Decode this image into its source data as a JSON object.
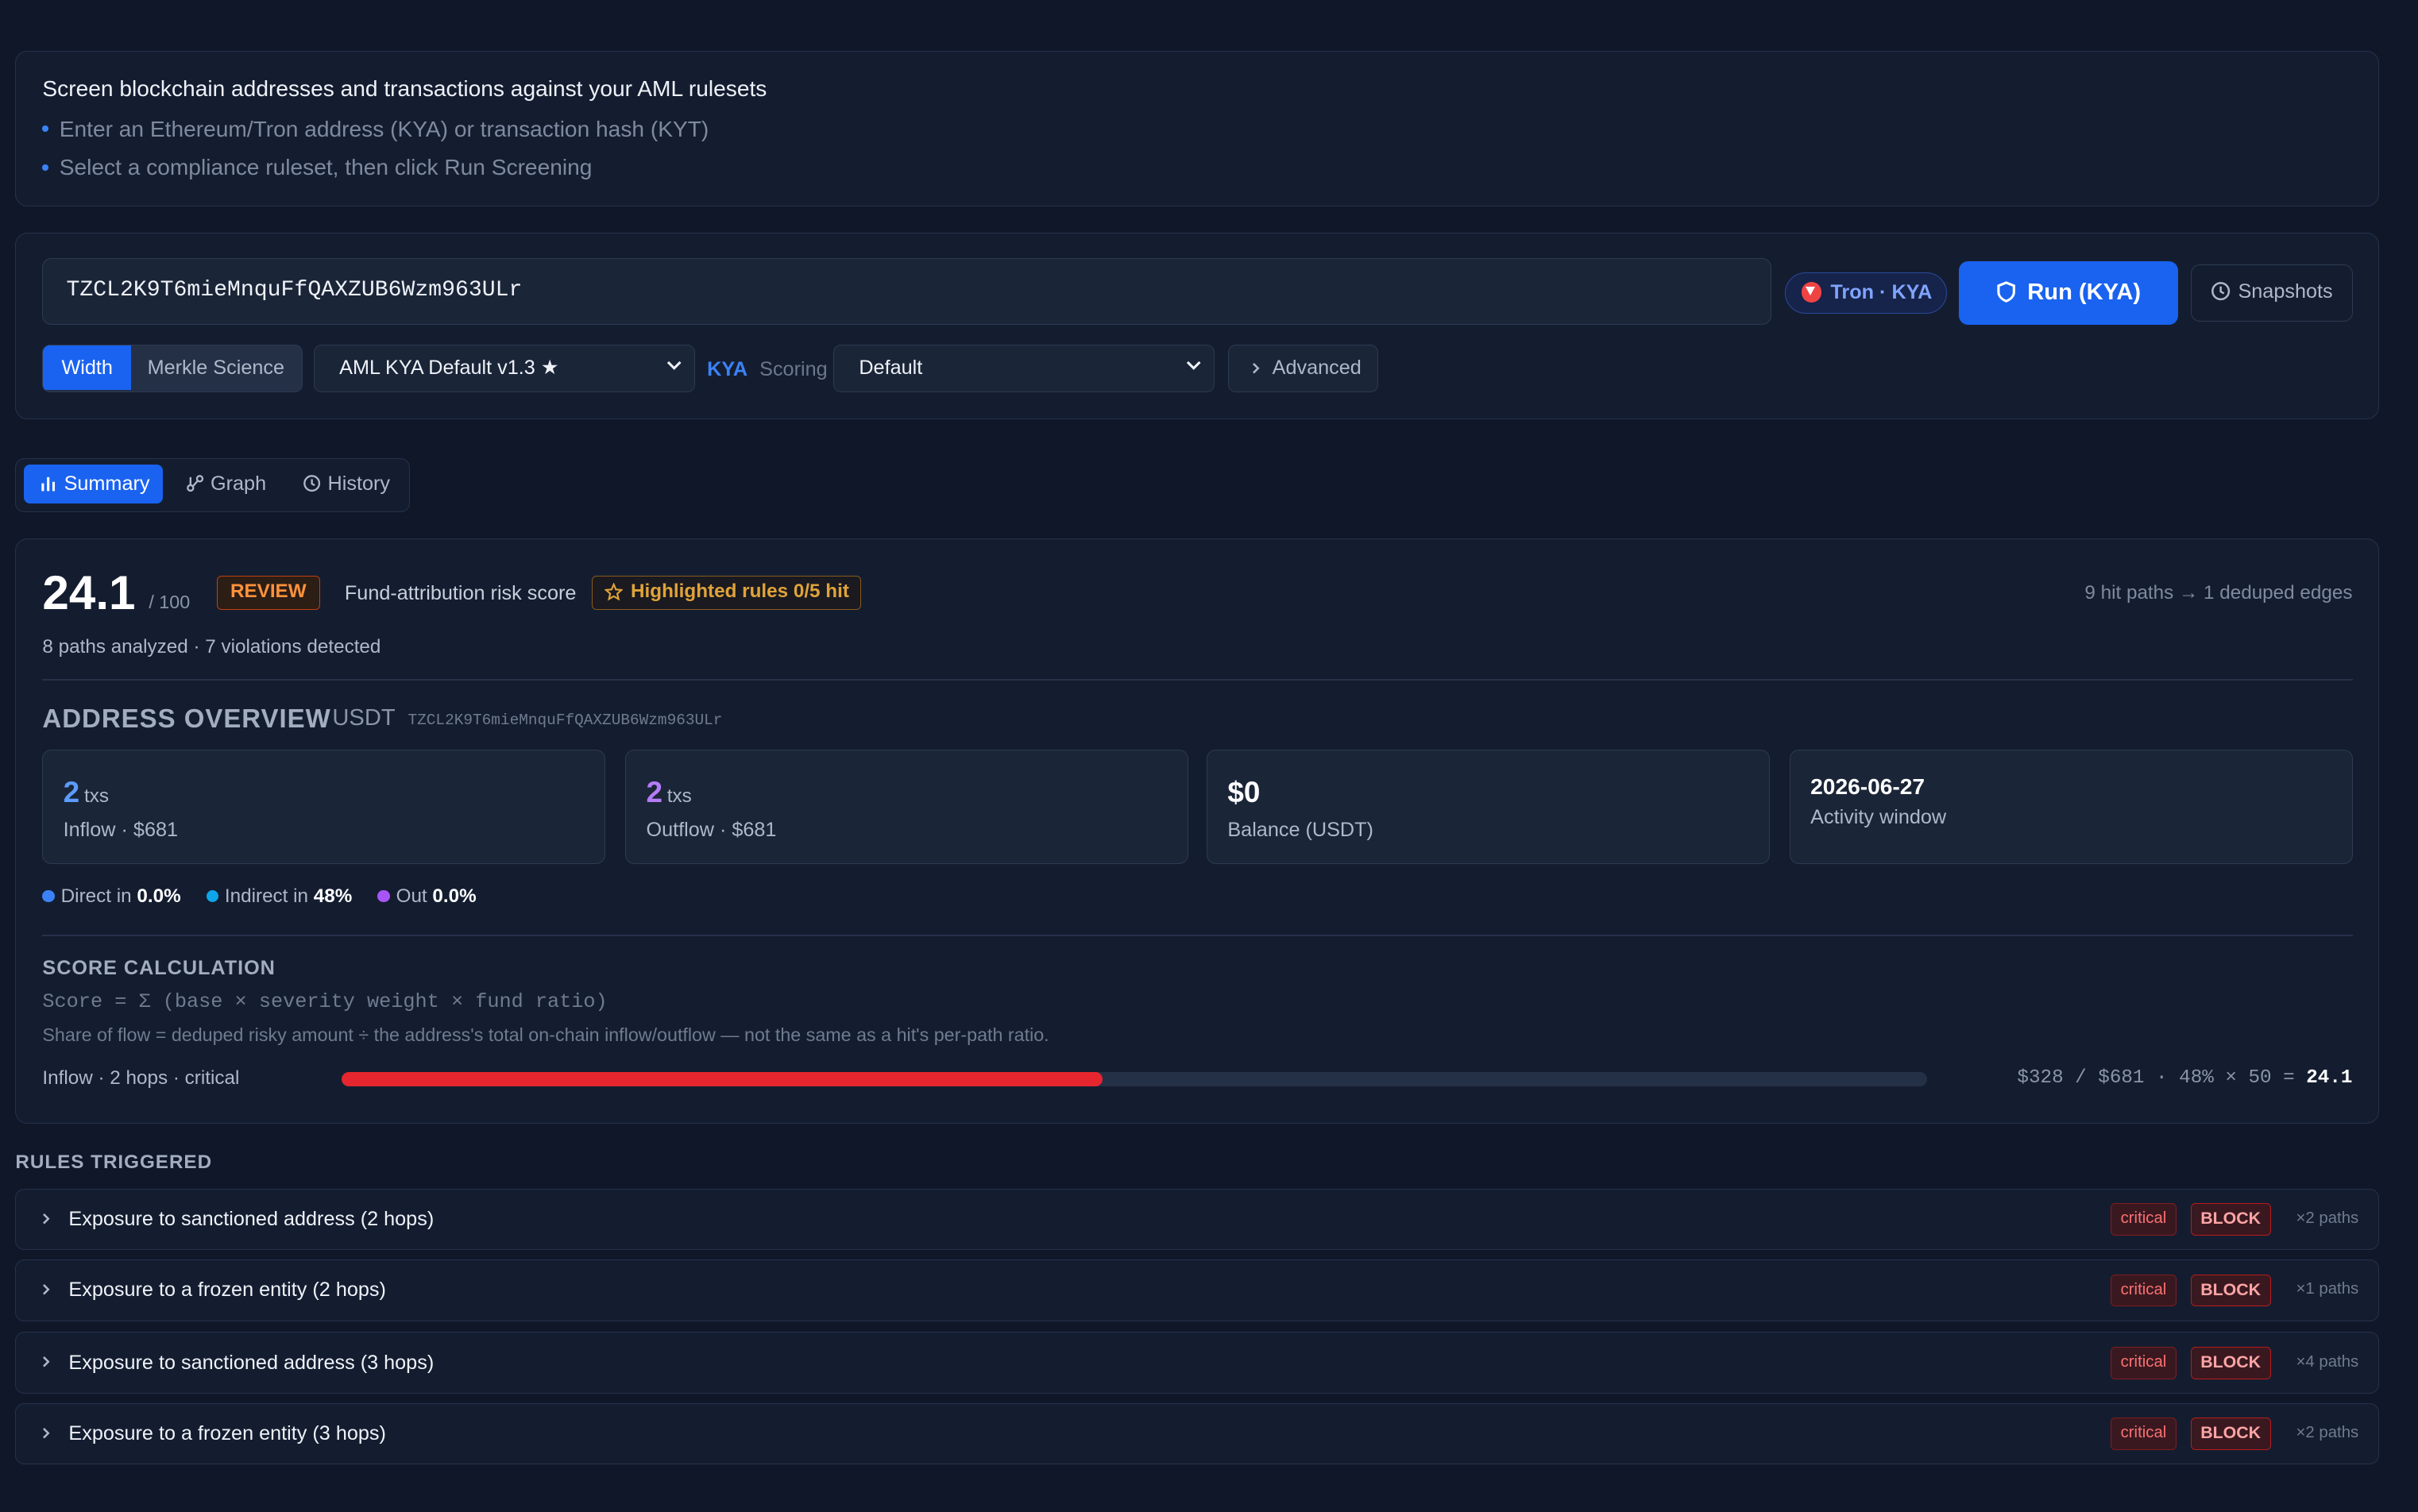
{
  "intro": {
    "title": "Screen blockchain addresses and transactions against your AML rulesets",
    "bullets": [
      "Enter an Ethereum/Tron address (KYA) or transaction hash (KYT)",
      "Select a compliance ruleset, then click Run Screening"
    ]
  },
  "input": {
    "address": "TZCL2K9T6mieMnquFfQAXZUB6Wzm963ULr",
    "chain_badge": "Tron · KYA",
    "run_label": "Run (KYA)",
    "snapshots_label": "Snapshots",
    "providers": [
      "Width",
      "Merkle Science"
    ],
    "ruleset": "AML KYA Default v1.3 ★",
    "mode_label": "KYA",
    "scoring_label": "Scoring",
    "scoring_value": "Default",
    "advanced_label": "Advanced"
  },
  "tabs": [
    "Summary",
    "Graph",
    "History"
  ],
  "summary": {
    "score": "24.1",
    "score_of": "/ 100",
    "verdict": "REVIEW",
    "score_label": "Fund-attribution risk score",
    "highlighted": "Highlighted rules 0/5 hit",
    "hit_paths": "9 hit paths → 1 deduped edges",
    "paths_line": "8 paths analyzed · 7 violations detected",
    "overview_title": "ADDRESS OVERVIEW",
    "overview_token": "USDT",
    "overview_address": "TZCL2K9T6mieMnquFfQAXZUB6Wzm963ULr",
    "cards": {
      "inflow": {
        "value": "2",
        "unit": "txs",
        "sub": "Inflow · $681"
      },
      "outflow": {
        "value": "2",
        "unit": "txs",
        "sub": "Outflow · $681"
      },
      "balance": {
        "value": "$0",
        "sub": "Balance (USDT)"
      },
      "window": {
        "value": "2026-06-27",
        "sub": "Activity window"
      }
    },
    "legend": [
      {
        "label": "Direct in",
        "value": "0.0%",
        "color": "#3b82f6"
      },
      {
        "label": "Indirect in",
        "value": "48%",
        "color": "#0ea5e9"
      },
      {
        "label": "Out",
        "value": "0.0%",
        "color": "#a855f7"
      }
    ],
    "calc_title": "SCORE CALCULATION",
    "calc_formula": "Score = Σ (base × severity weight × fund ratio)",
    "calc_desc": "Share of flow = deduped risky amount ÷ the address's total on-chain inflow/outflow — not the same as a hit's per-path ratio.",
    "bar_label": "Inflow · 2 hops · critical",
    "bar_fraction": 0.48,
    "bar_formula": "$328 / $681 · 48% × 50 =",
    "bar_result": "24.1"
  },
  "rules_title": "RULES TRIGGERED",
  "rules": [
    {
      "name": "Exposure to sanctioned address (2 hops)",
      "severity": "critical",
      "action": "BLOCK",
      "count": "×2 paths"
    },
    {
      "name": "Exposure to a frozen entity (2 hops)",
      "severity": "critical",
      "action": "BLOCK",
      "count": "×1 paths"
    },
    {
      "name": "Exposure to sanctioned address (3 hops)",
      "severity": "critical",
      "action": "BLOCK",
      "count": "×4 paths"
    },
    {
      "name": "Exposure to a frozen entity (3 hops)",
      "severity": "critical",
      "action": "BLOCK",
      "count": "×2 paths"
    }
  ],
  "colors": {
    "accent": "#1a63f0",
    "review": "#fb923c",
    "critical": "#f87171",
    "bar": "#e5262e"
  }
}
